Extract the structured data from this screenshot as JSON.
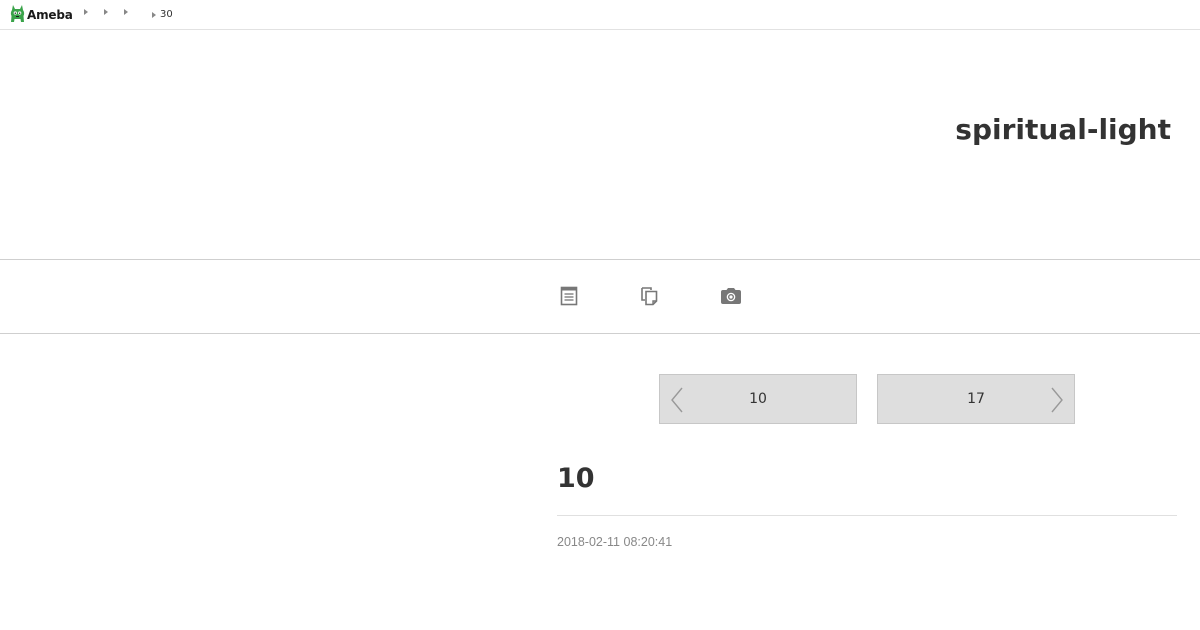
{
  "brand": {
    "logo_text": "Ameba"
  },
  "breadcrumb": {
    "items": [
      "",
      "",
      "",
      "30"
    ]
  },
  "blog": {
    "title": "spiritual-light"
  },
  "nav": {
    "icons": [
      "document-icon",
      "pages-icon",
      "camera-icon"
    ]
  },
  "pager": {
    "prev_label": "10",
    "next_label": "17"
  },
  "entry": {
    "title": "10",
    "date": "2018-02-11 08:20:41"
  },
  "colors": {
    "background": "#ffffff",
    "text": "#333333",
    "muted": "#888888",
    "pager_bg": "#dedede",
    "logo_green": "#3aa34a"
  }
}
